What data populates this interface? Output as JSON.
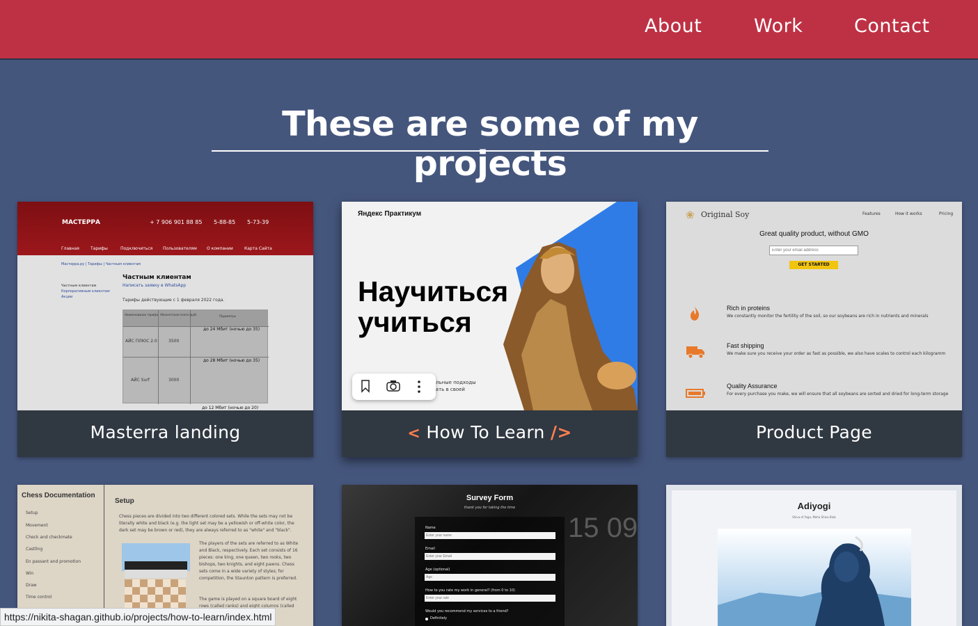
{
  "nav": {
    "about": "About",
    "work": "Work",
    "contact": "Contact"
  },
  "heading": "These are some of my projects",
  "projects": [
    {
      "title": "Masterra landing",
      "preview": {
        "brand": "МАСТЕРРА",
        "phone1": "+ 7 906 901 88 85",
        "phone2": "5-88-85",
        "phone3": "5-73-39",
        "menu": [
          "Главная",
          "Тарифы",
          "Подключиться",
          "Пользователям",
          "О компании",
          "Карта Сайта"
        ],
        "crumbs": "Мастерра.ру  |  Тарифы  |  Частным клиентам",
        "side": [
          "Частным клиентам",
          "Корпоративным клиентам",
          "Акции"
        ],
        "h": "Частным клиентам",
        "link": "Написать заявку в WhatsApp",
        "note": "Тарифы действующие с 1 февраля 2022 года.",
        "th": [
          "Наименование тарифа",
          "Абонентская плата (руб)",
          "Параметры"
        ],
        "rows": [
          {
            "name": "АЙС ПЛЮС 2.0",
            "price": "3500",
            "p": "до 24 Мбит (ночью до 35)"
          },
          {
            "name": "АЙС Surf",
            "price": "3000",
            "p": "до 28 Мбит (ночью до 35)"
          }
        ],
        "more": "до 12 Мбит (ночью до 20)"
      }
    },
    {
      "title": "How To Learn",
      "left_bracket": "<",
      "right_bracket": "/>",
      "preview": {
        "brand": "Яндекс Практикум",
        "headline1": "Научиться",
        "headline2": "учиться",
        "sub1": "...ельные подходы",
        "sub2": "...вать в своей"
      }
    },
    {
      "title": "Product Page",
      "preview": {
        "brand": "Original Soy",
        "links": [
          "Features",
          "How it works",
          "Pricing"
        ],
        "hero": "Great quality product, without GMO",
        "email_placeholder": "Enter your email address",
        "cta": "GET STARTED",
        "features": [
          {
            "icon": "flame-icon",
            "title": "Rich in proteins",
            "text": "We constantly monitor the fertility of the soil, so our soybeans are rich in nutrients and minerals"
          },
          {
            "icon": "truck-icon",
            "title": "Fast shipping",
            "text": "We make sure you receive your order as fast as possible, we also have scales to control each kilogramm"
          },
          {
            "icon": "battery-icon",
            "title": "Quality Assurance",
            "text": "For every purchase you make, we will ensure that all soybeans are sorted and dried for long-term storage"
          }
        ]
      }
    },
    {
      "title": "Chess Documentation",
      "preview": {
        "sidebar_title": "Chess Documentation",
        "nav": [
          "Setup",
          "Movement",
          "Check and checkmate",
          "Castling",
          "En passant and promotion",
          "Win",
          "Draw",
          "Time control"
        ],
        "section": "Setup",
        "p1": "Chess pieces are divided into two different colored sets. While the sets may not be literally white and black (e.g. the light set may be a yellowish or off-white color, the dark set may be brown or red), they are always referred to as \"white\" and \"black\".",
        "p2": "The players of the sets are referred to as White and Black, respectively. Each set consists of 16 pieces: one king, one queen, two rooks, two bishops, two knights, and eight pawns. Chess sets come in a wide variety of styles; for competition, the Staunton pattern is preferred.",
        "p3": "The game is played on a square board of eight rows (called ranks) and eight columns (called files)."
      }
    },
    {
      "title": "Survey Form",
      "preview": {
        "title": "Survey Form",
        "subtitle": "thank you for taking the time",
        "fields": [
          {
            "label": "Name",
            "placeholder": "Enter your name"
          },
          {
            "label": "Email",
            "placeholder": "Enter your Email"
          },
          {
            "label": "Age (optional)",
            "placeholder": "Age"
          },
          {
            "label": "How to you rate my work in general? (from 0 to 10)",
            "placeholder": "Enter your rate"
          }
        ],
        "question": "Would you recommend my services to a friend?",
        "option": "Definitely",
        "clock": "15 09"
      }
    },
    {
      "title": "Adiyogi",
      "preview": {
        "title": "Adiyogi",
        "subtitle": "Shiva of Yoga, Maha Shiva Blub"
      }
    }
  ],
  "toolbar_icons": [
    "bookmark-icon",
    "camera-icon",
    "more-icon"
  ],
  "status_url": "https://nikita-shagan.github.io/projects/how-to-learn/index.html"
}
